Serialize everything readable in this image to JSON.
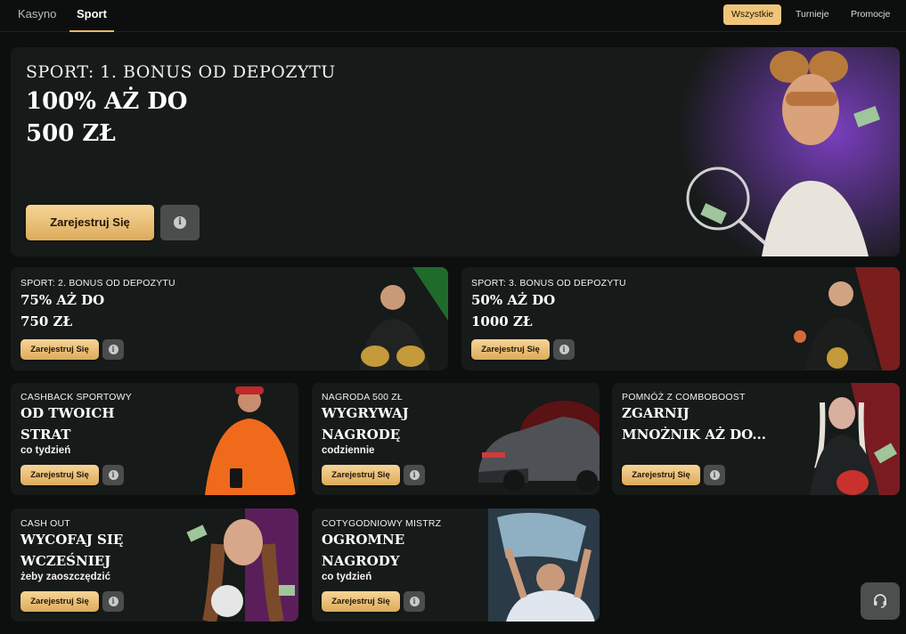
{
  "tabs": [
    {
      "label": "Kasyno",
      "active": false
    },
    {
      "label": "Sport",
      "active": true
    }
  ],
  "filters": [
    {
      "label": "Wszystkie",
      "active": true
    },
    {
      "label": "Turnieje",
      "active": false
    },
    {
      "label": "Promocje",
      "active": false
    }
  ],
  "hero": {
    "kicker": "SPORT: 1. BONUS OD DEPOZYTU",
    "line1": "100% AŻ DO",
    "line2": "500 ZŁ",
    "cta": "Zarejestruj Się",
    "info_icon": "info-icon"
  },
  "promos": [
    {
      "kicker": "SPORT: 2. BONUS OD DEPOZYTU",
      "line1": "75% AŻ DO",
      "line2": "750 ZŁ",
      "sub": "",
      "cta": "Zarejestruj Się"
    },
    {
      "kicker": "SPORT: 3. BONUS OD DEPOZYTU",
      "line1": "50% AŻ DO",
      "line2": "1000 ZŁ",
      "sub": "",
      "cta": "Zarejestruj Się"
    },
    {
      "kicker": "CASHBACK SPORTOWY",
      "line1": "OD TWOICH",
      "line2": "STRAT",
      "sub": "co tydzień",
      "cta": "Zarejestruj Się"
    },
    {
      "kicker": "NAGRODA 500 ZŁ",
      "line1": "WYGRYWAJ",
      "line2": "NAGRODĘ",
      "sub": "codziennie",
      "cta": "Zarejestruj Się"
    },
    {
      "kicker": "POMNÓŻ Z COMBOBOOST",
      "line1": "ZGARNIJ",
      "line2": "MNOŻNIK AŻ DO...",
      "sub": "",
      "cta": "Zarejestruj Się"
    },
    {
      "kicker": "CASH OUT",
      "line1": "WYCOFAJ SIĘ",
      "line2": "WCZEŚNIEJ",
      "sub": "żeby zaoszczędzić",
      "cta": "Zarejestruj Się"
    },
    {
      "kicker": "COTYGODNIOWY MISTRZ",
      "line1": "OGROMNE",
      "line2": "NAGRODY",
      "sub": "co tydzień",
      "cta": "Zarejestruj Się"
    }
  ],
  "support_icon": "headset-icon",
  "colors": {
    "accent": "#f0c57a",
    "background": "#0d0f0e",
    "card": "#161a18"
  }
}
